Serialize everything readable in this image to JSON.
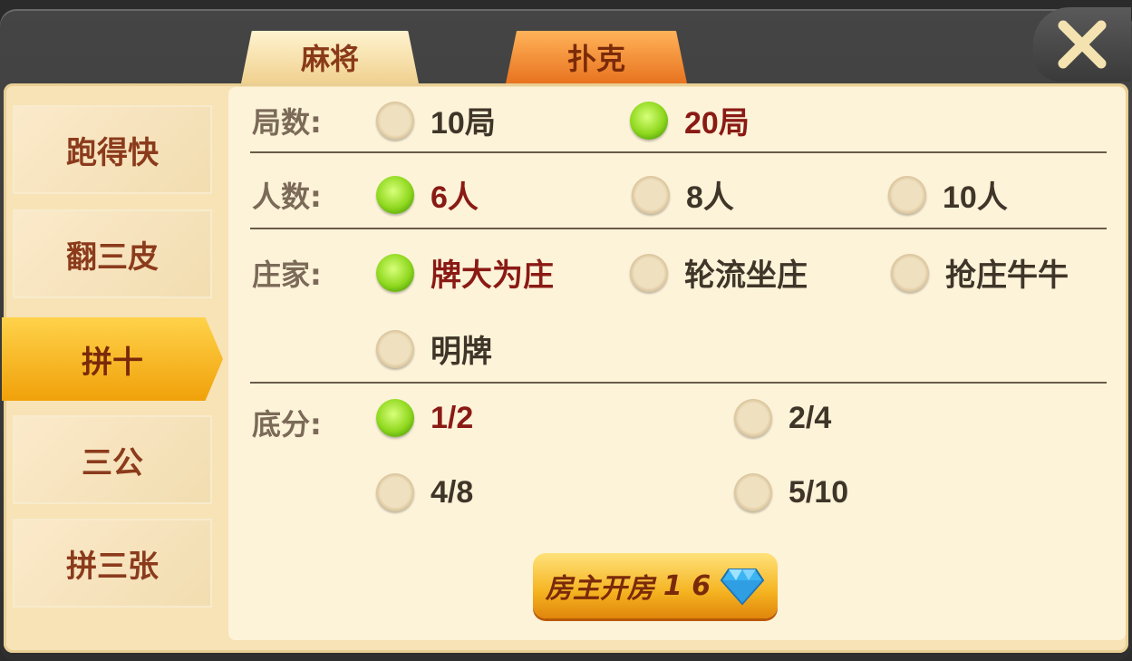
{
  "tabs": [
    {
      "label": "麻将"
    },
    {
      "label": "扑克"
    }
  ],
  "sidebar": {
    "items": [
      {
        "label": "跑得快"
      },
      {
        "label": "翻三皮"
      },
      {
        "label": "拼十"
      },
      {
        "label": "三公"
      },
      {
        "label": "拼三张"
      }
    ],
    "active": "拼十"
  },
  "settings": {
    "rounds": {
      "label": "局数:",
      "options": [
        "10局",
        "20局"
      ],
      "selected": "20局"
    },
    "players": {
      "label": "人数:",
      "options": [
        "6人",
        "8人",
        "10人"
      ],
      "selected": "6人"
    },
    "banker": {
      "label": "庄家:",
      "options": [
        "牌大为庄",
        "轮流坐庄",
        "抢庄牛牛",
        "明牌"
      ],
      "selected": "牌大为庄"
    },
    "base_score": {
      "label": "底分:",
      "options": [
        "1/2",
        "2/4",
        "4/8",
        "5/10"
      ],
      "selected": "1/2"
    }
  },
  "create_button": {
    "label": "房主开房",
    "cost": "1 6",
    "icon": "diamond-icon"
  },
  "close_icon": "close-icon",
  "colors": {
    "selected_radio": "#8fd81e",
    "selected_text": "#8a1a14",
    "accent_tab": "#e8731f",
    "active_sidebar": "#f0a10a"
  }
}
